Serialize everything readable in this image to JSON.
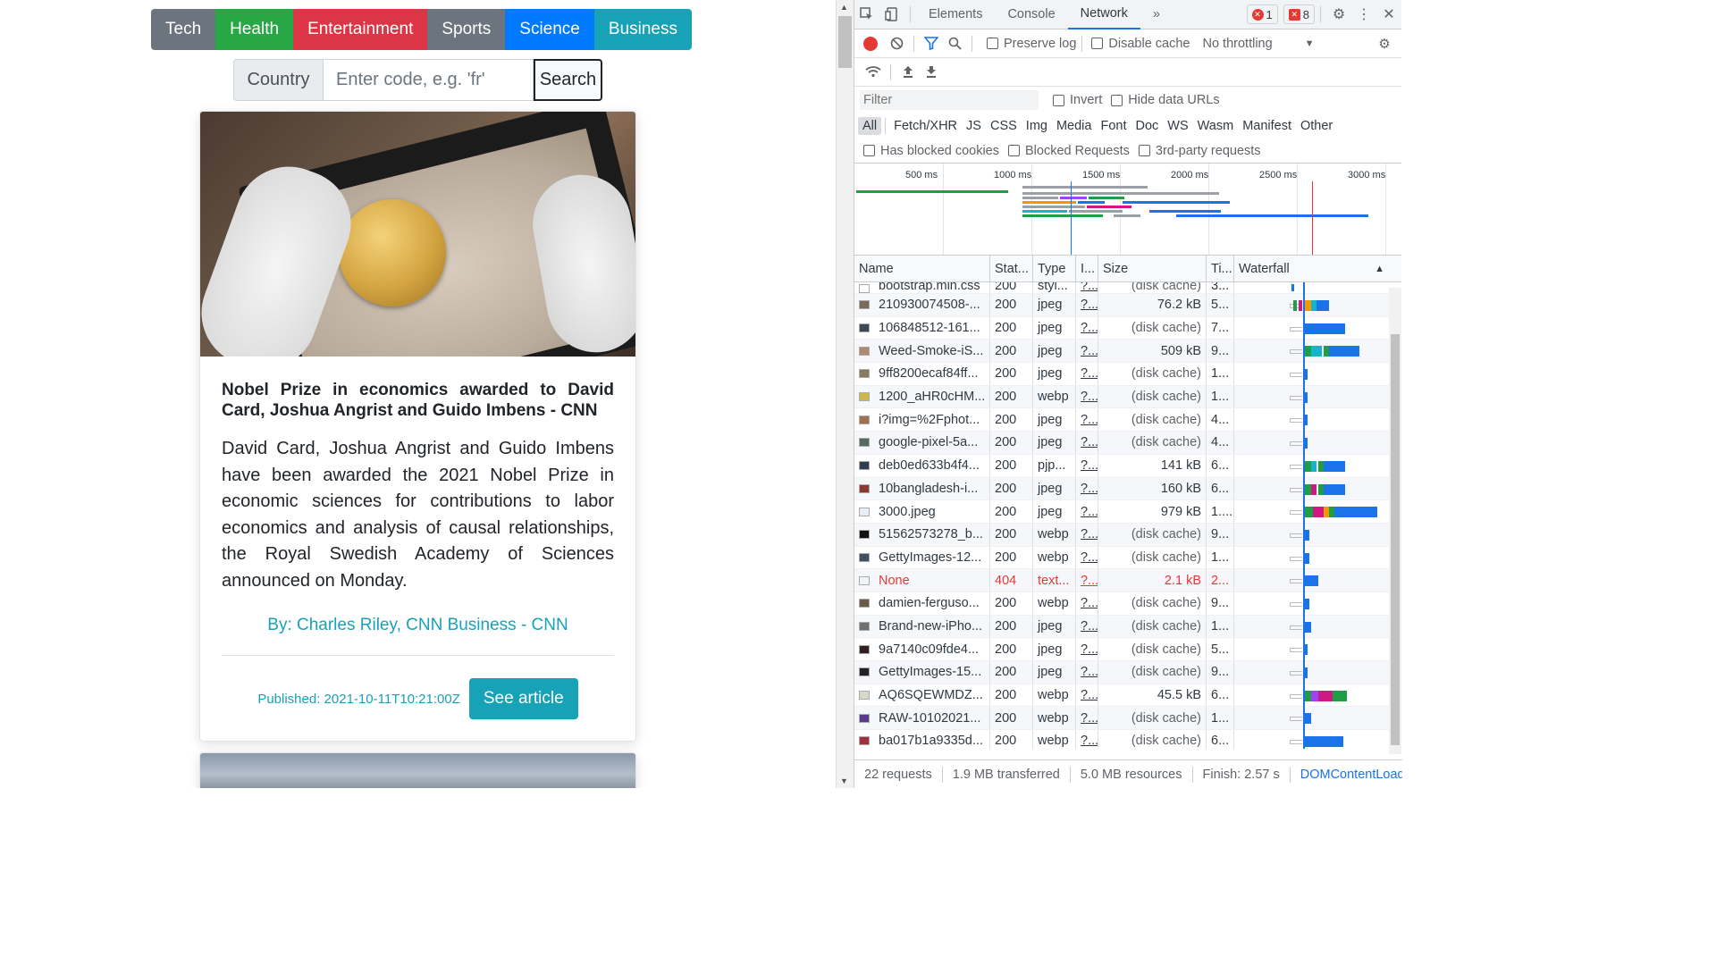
{
  "categories": [
    "Tech",
    "Health",
    "Entertainment",
    "Sports",
    "Science",
    "Business"
  ],
  "search": {
    "label": "Country",
    "placeholder": "Enter code, e.g. 'fr'",
    "button": "Search"
  },
  "article": {
    "title": "Nobel Prize in economics awarded to David Card, Joshua Angrist and Guido Imbens - CNN",
    "description": "David Card, Joshua Angrist and Guido Imbens have been awarded the 2021 Nobel Prize in economic sciences for contributions to labor economics and analysis of causal relationships, the Royal Swedish Academy of Sciences announced on Monday.",
    "author": "By: Charles Riley, CNN Business - CNN",
    "published": "Published: 2021-10-11T10:21:00Z",
    "button": "See article"
  },
  "devtools": {
    "tabs": [
      "Elements",
      "Console",
      "Network"
    ],
    "more": "»",
    "errors": "1",
    "warnings": "8",
    "preserve_log": "Preserve log",
    "disable_cache": "Disable cache",
    "throttling": "No throttling",
    "filter_placeholder": "Filter",
    "invert": "Invert",
    "hide_data_urls": "Hide data URLs",
    "types": [
      "All",
      "Fetch/XHR",
      "JS",
      "CSS",
      "Img",
      "Media",
      "Font",
      "Doc",
      "WS",
      "Wasm",
      "Manifest",
      "Other"
    ],
    "has_blocked_cookies": "Has blocked cookies",
    "blocked_requests": "Blocked Requests",
    "third_party": "3rd-party requests",
    "timeline_labels": [
      "500 ms",
      "1000 ms",
      "1500 ms",
      "2000 ms",
      "2500 ms",
      "3000 ms"
    ],
    "columns": [
      "Name",
      "Stat...",
      "Type",
      "I...",
      "Size",
      "Ti...",
      "Waterfall"
    ],
    "rows": [
      {
        "name": "bootstrap.min.css",
        "status": "200",
        "type": "styl...",
        "init": "?...",
        "size": "(disk cache)",
        "time": "3..."
      },
      {
        "name": "210930074508-...",
        "status": "200",
        "type": "jpeg",
        "init": "?...",
        "size": "76.2 kB",
        "time": "5..."
      },
      {
        "name": "106848512-161...",
        "status": "200",
        "type": "jpeg",
        "init": "?...",
        "size": "(disk cache)",
        "time": "7..."
      },
      {
        "name": "Weed-Smoke-iS...",
        "status": "200",
        "type": "jpeg",
        "init": "?...",
        "size": "509 kB",
        "time": "9..."
      },
      {
        "name": "9ff8200ecaf84ff...",
        "status": "200",
        "type": "jpeg",
        "init": "?...",
        "size": "(disk cache)",
        "time": "1..."
      },
      {
        "name": "1200_aHR0cHM...",
        "status": "200",
        "type": "webp",
        "init": "?...",
        "size": "(disk cache)",
        "time": "1..."
      },
      {
        "name": "i?img=%2Fphot...",
        "status": "200",
        "type": "jpeg",
        "init": "?...",
        "size": "(disk cache)",
        "time": "4..."
      },
      {
        "name": "google-pixel-5a...",
        "status": "200",
        "type": "jpeg",
        "init": "?...",
        "size": "(disk cache)",
        "time": "4..."
      },
      {
        "name": "deb0ed633b4f4...",
        "status": "200",
        "type": "pjp...",
        "init": "?...",
        "size": "141 kB",
        "time": "6..."
      },
      {
        "name": "10bangladesh-i...",
        "status": "200",
        "type": "jpeg",
        "init": "?...",
        "size": "160 kB",
        "time": "6..."
      },
      {
        "name": "3000.jpeg",
        "status": "200",
        "type": "jpeg",
        "init": "?...",
        "size": "979 kB",
        "time": "1...."
      },
      {
        "name": "51562573278_b...",
        "status": "200",
        "type": "webp",
        "init": "?...",
        "size": "(disk cache)",
        "time": "9..."
      },
      {
        "name": "GettyImages-12...",
        "status": "200",
        "type": "webp",
        "init": "?...",
        "size": "(disk cache)",
        "time": "1..."
      },
      {
        "name": "None",
        "status": "404",
        "type": "text...",
        "init": "?...",
        "size": "2.1 kB",
        "time": "2...",
        "error": true
      },
      {
        "name": "damien-ferguso...",
        "status": "200",
        "type": "webp",
        "init": "?...",
        "size": "(disk cache)",
        "time": "9..."
      },
      {
        "name": "Brand-new-iPho...",
        "status": "200",
        "type": "jpeg",
        "init": "?...",
        "size": "(disk cache)",
        "time": "1..."
      },
      {
        "name": "9a7140c09fde4...",
        "status": "200",
        "type": "jpeg",
        "init": "?...",
        "size": "(disk cache)",
        "time": "5..."
      },
      {
        "name": "GettyImages-15...",
        "status": "200",
        "type": "jpeg",
        "init": "?...",
        "size": "(disk cache)",
        "time": "9..."
      },
      {
        "name": "AQ6SQEWMDZ...",
        "status": "200",
        "type": "webp",
        "init": "?...",
        "size": "45.5 kB",
        "time": "6..."
      },
      {
        "name": "RAW-10102021...",
        "status": "200",
        "type": "webp",
        "init": "?...",
        "size": "(disk cache)",
        "time": "1..."
      },
      {
        "name": "ba017b1a9335d...",
        "status": "200",
        "type": "webp",
        "init": "?...",
        "size": "(disk cache)",
        "time": "6..."
      }
    ],
    "status": {
      "requests": "22 requests",
      "transferred": "1.9 MB transferred",
      "resources": "5.0 MB resources",
      "finish": "Finish: 2.57 s",
      "dom": "DOMContentLoaded"
    }
  }
}
